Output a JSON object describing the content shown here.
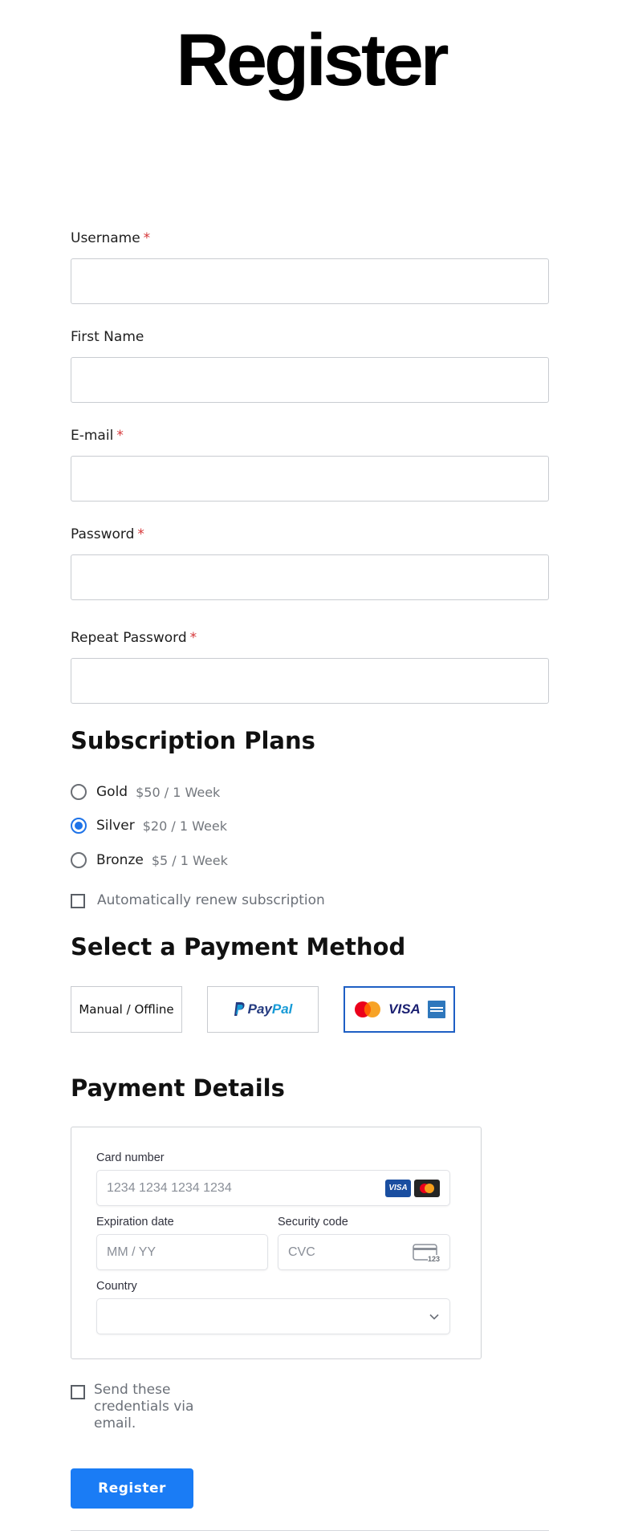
{
  "page": {
    "title": "Register"
  },
  "fields": [
    {
      "label": "Username",
      "required": "*",
      "value": ""
    },
    {
      "label": "First Name",
      "value": ""
    },
    {
      "label": "E-mail",
      "required": "*",
      "value": ""
    },
    {
      "label": "Password",
      "required": "*",
      "value": ""
    },
    {
      "label": "Repeat Password",
      "required": "*",
      "value": ""
    }
  ],
  "subscription": {
    "heading": "Subscription Plans",
    "plans": [
      {
        "name": "Gold",
        "price": "$50 / 1 Week",
        "selected": false
      },
      {
        "name": "Silver",
        "price": "$20 / 1 Week",
        "selected": true
      },
      {
        "name": "Bronze",
        "price": "$5 / 1 Week",
        "selected": false
      }
    ],
    "auto_renew_label": "Automatically renew subscription",
    "auto_renew_checked": false
  },
  "payment_method": {
    "heading": "Select a Payment Method",
    "options": [
      {
        "label": "Manual / Offline",
        "selected": false
      },
      {
        "label_part1": "Pay",
        "label_part2": "Pal",
        "selected": false
      },
      {
        "label": "VISA",
        "selected": true,
        "icons": [
          "mastercard-icon",
          "visa-icon",
          "amex-icon"
        ]
      }
    ]
  },
  "payment_details": {
    "heading": "Payment Details",
    "card_number": {
      "label": "Card number",
      "placeholder": "1234 1234 1234 1234",
      "brand_icons": [
        "VISA",
        "mastercard"
      ]
    },
    "expiration": {
      "label": "Expiration date",
      "placeholder": "MM / YY"
    },
    "security": {
      "label": "Security code",
      "placeholder": "CVC",
      "icon_text": "123"
    },
    "country": {
      "label": "Country",
      "value": ""
    }
  },
  "send_credentials": {
    "label": "Send these credentials via email.",
    "checked": false
  },
  "submit": {
    "label": "Register"
  },
  "colors": {
    "accent": "#1a7cf5",
    "required": "#d63638",
    "radio_selected": "#1e73e8"
  }
}
